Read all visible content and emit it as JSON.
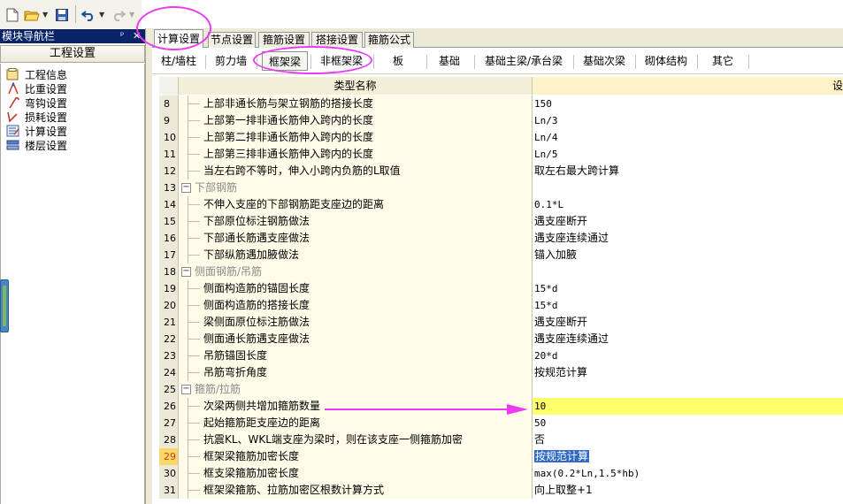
{
  "toolbar": {
    "buttons": [
      "new-file-icon",
      "open-folder-icon",
      "save-icon",
      "undo-icon",
      "redo-icon"
    ]
  },
  "nav": {
    "title": "模块导航栏",
    "pin": "ᵖ",
    "close": "✕",
    "header": "工程设置",
    "items": [
      {
        "label": "工程信息",
        "icon": "project-info-icon"
      },
      {
        "label": "比重设置",
        "icon": "weight-icon"
      },
      {
        "label": "弯钩设置",
        "icon": "hook-icon"
      },
      {
        "label": "损耗设置",
        "icon": "loss-icon"
      },
      {
        "label": "计算设置",
        "icon": "calc-settings-icon"
      },
      {
        "label": "楼层设置",
        "icon": "floor-icon"
      }
    ]
  },
  "tabs": [
    "计算设置",
    "节点设置",
    "箍筋设置",
    "搭接设置",
    "箍筋公式"
  ],
  "subtabs": [
    "柱/墙柱",
    "剪力墙",
    "框架梁",
    "非框架梁",
    "板",
    "基础",
    "基础主梁/承台梁",
    "基础次梁",
    "砌体结构",
    "其它"
  ],
  "grid": {
    "col_name": "类型名称",
    "col_value_fragment": "设",
    "rows": [
      {
        "num": "8",
        "name": "上部非通长筋与架立钢筋的搭接长度",
        "value": "150"
      },
      {
        "num": "9",
        "name": "上部第一排非通长筋伸入跨内的长度",
        "value": "Ln/3"
      },
      {
        "num": "10",
        "name": "上部第二排非通长筋伸入跨内的长度",
        "value": "Ln/4"
      },
      {
        "num": "11",
        "name": "上部第三排非通长筋伸入跨内的长度",
        "value": "Ln/5"
      },
      {
        "num": "12",
        "name": "当左右跨不等时，伸入小跨内负筋的L取值",
        "value": "取左右最大跨计算"
      },
      {
        "num": "13",
        "name": "下部钢筋",
        "value": "",
        "group": true
      },
      {
        "num": "14",
        "name": "不伸入支座的下部钢筋距支座边的距离",
        "value": "0.1*L"
      },
      {
        "num": "15",
        "name": "下部原位标注钢筋做法",
        "value": "遇支座断开"
      },
      {
        "num": "16",
        "name": "下部通长筋遇支座做法",
        "value": "遇支座连续通过"
      },
      {
        "num": "17",
        "name": "下部纵筋遇加腋做法",
        "value": "锚入加腋"
      },
      {
        "num": "18",
        "name": "侧面钢筋/吊筋",
        "value": "",
        "group": true
      },
      {
        "num": "19",
        "name": "侧面构造筋的锚固长度",
        "value": "15*d"
      },
      {
        "num": "20",
        "name": "侧面构造筋的搭接长度",
        "value": "15*d"
      },
      {
        "num": "21",
        "name": "梁侧面原位标注筋做法",
        "value": "遇支座断开"
      },
      {
        "num": "22",
        "name": "侧面通长筋遇支座做法",
        "value": "遇支座连续通过"
      },
      {
        "num": "23",
        "name": "吊筋锚固长度",
        "value": "20*d"
      },
      {
        "num": "24",
        "name": "吊筋弯折角度",
        "value": "按规范计算"
      },
      {
        "num": "25",
        "name": "箍筋/拉筋",
        "value": "",
        "group": true
      },
      {
        "num": "26",
        "name": "次梁两侧共增加箍筋数量",
        "value": "10",
        "highlight": true
      },
      {
        "num": "27",
        "name": "起始箍筋距支座边的距离",
        "value": "50"
      },
      {
        "num": "28",
        "name": "抗震KL、WKL端支座为梁时，则在该支座一侧箍筋加密",
        "value": "否"
      },
      {
        "num": "29",
        "name": "框架梁箍筋加密长度",
        "value": "按规范计算",
        "selected": true
      },
      {
        "num": "30",
        "name": "框支梁箍筋加密长度",
        "value": "max(0.2*Ln,1.5*hb)"
      },
      {
        "num": "31",
        "name": "框架梁箍筋、拉筋加密区根数计算方式",
        "value": "向上取整+1"
      }
    ]
  },
  "colors": {
    "annotation": "#ea3cf0",
    "highlight_row": "#ffff6b",
    "selection": "#3169c6"
  }
}
